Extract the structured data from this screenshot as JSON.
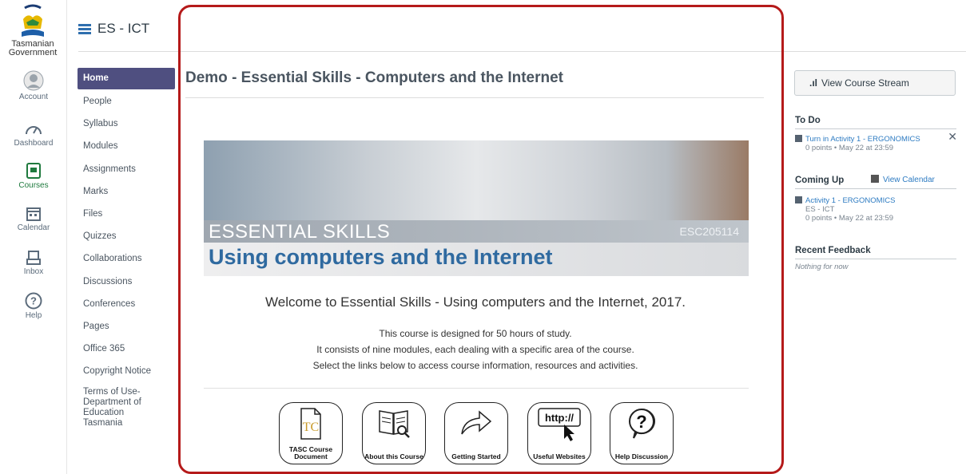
{
  "logo": {
    "text": "Tasmanian Government"
  },
  "global_nav": [
    {
      "label": "Account",
      "icon": "account-icon"
    },
    {
      "label": "Dashboard",
      "icon": "dashboard-icon"
    },
    {
      "label": "Courses",
      "icon": "courses-icon"
    },
    {
      "label": "Calendar",
      "icon": "calendar-icon"
    },
    {
      "label": "Inbox",
      "icon": "inbox-icon"
    },
    {
      "label": "Help",
      "icon": "help-icon"
    }
  ],
  "header": {
    "title": "ES - ICT"
  },
  "course_nav": [
    "Home",
    "People",
    "Syllabus",
    "Modules",
    "Assignments",
    "Marks",
    "Files",
    "Quizzes",
    "Collaborations",
    "Discussions",
    "Conferences",
    "Pages",
    "Office 365",
    "Copyright Notice",
    "Terms of Use- Department of Education Tasmania"
  ],
  "main": {
    "page_title": "Demo - Essential Skills - Computers and the Internet",
    "banner": {
      "heading": "ESSENTIAL SKILLS",
      "code": "ESC205114",
      "subheading": "Using computers and the Internet"
    },
    "welcome": "Welcome to Essential Skills - Using computers and the Internet, 2017.",
    "desc_lines": [
      "This course is designed for 50 hours of study.",
      "It consists of nine modules, each dealing with a specific area of the course.",
      "Select the links below to access course information, resources and activities."
    ],
    "icon_buttons": [
      {
        "label": "TASC Course Document",
        "icon": "document-icon"
      },
      {
        "label": "About this Course",
        "icon": "book-magnifier-icon"
      },
      {
        "label": "Getting Started",
        "icon": "arrow-icon"
      },
      {
        "label": "Useful Websites",
        "icon": "http-cursor-icon",
        "icon_text": "http://"
      },
      {
        "label": "Help Discussion",
        "icon": "question-bubble-icon",
        "icon_text": "?"
      }
    ]
  },
  "sidebar": {
    "stream_button": "View Course Stream",
    "todo": {
      "heading": "To Do",
      "item_link": "Turn in Activity 1 - ERGONOMICS",
      "item_meta": "0 points • May 22 at 23:59"
    },
    "coming_up": {
      "heading": "Coming Up",
      "view_calendar": "View Calendar",
      "item_link": "Activity 1 - ERGONOMICS",
      "item_course": "ES - ICT",
      "item_meta": "0 points • May 22 at 23:59"
    },
    "recent_feedback": {
      "heading": "Recent Feedback",
      "empty": "Nothing for now"
    }
  },
  "colors": {
    "active_nav": "#4f4f80",
    "highlight_frame": "#b51a1a",
    "link": "#2d7bc2",
    "banner_text": "#2f6aa0"
  }
}
